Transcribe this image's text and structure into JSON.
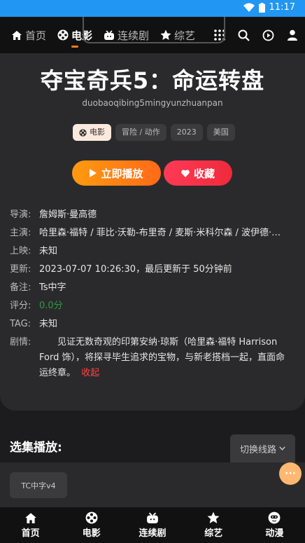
{
  "status": {
    "time": "11:17"
  },
  "top_nav": {
    "items": [
      {
        "label": "首页",
        "icon": "home-icon",
        "active": false
      },
      {
        "label": "电影",
        "icon": "film-reel-icon",
        "active": true
      },
      {
        "label": "连续剧",
        "icon": "tv-icon",
        "active": false
      },
      {
        "label": "综艺",
        "icon": "star-icon",
        "active": false
      }
    ]
  },
  "movie": {
    "title": "夺宝奇兵5：命运转盘",
    "pinyin": "duobaoqibing5mingyunzhuanpan",
    "tags": {
      "category": "电影",
      "genre": "冒险 / 动作",
      "year": "2023",
      "region": "美国"
    },
    "play_label": "立即播放",
    "fav_label": "收藏",
    "info": {
      "director_label": "导演:",
      "director": "詹姆斯·曼高德",
      "cast_label": "主演:",
      "cast": "哈里森·福特 / 菲比·沃勒-布里奇 / 麦斯·米科尔森 / 波伊德·霍布...",
      "release_label": "上映:",
      "release": "未知",
      "update_label": "更新:",
      "update": "2023-07-07 10:26:30，最后更新于 50分钟前",
      "note_label": "备注:",
      "note": "Ts中字",
      "rating_label": "评分:",
      "rating": "0.0分",
      "tag_label": "TAG:",
      "tag": "未知",
      "plot_label": "剧情:",
      "plot": "见证无数奇观的印第安纳·琼斯（哈里森·福特 Harrison Ford 饰），将探寻毕生追求的宝物，与新老搭档一起，直面命运终章。",
      "collapse_label": "收起"
    }
  },
  "episodes": {
    "section_title": "选集播放:",
    "switch_label": "切换线路",
    "items": [
      "TC中字v4"
    ]
  },
  "fab_label": "···",
  "bottom_nav": {
    "items": [
      {
        "label": "首页",
        "icon": "home-icon"
      },
      {
        "label": "电影",
        "icon": "film-reel-icon"
      },
      {
        "label": "连续剧",
        "icon": "tv-icon"
      },
      {
        "label": "综艺",
        "icon": "star-icon"
      },
      {
        "label": "动漫",
        "icon": "smiley-icon"
      }
    ]
  },
  "colors": {
    "status_bar": "#2196f3",
    "accent": "#ff7a1a",
    "favorite": "#ee2a3c",
    "rating": "#2e9b47"
  }
}
